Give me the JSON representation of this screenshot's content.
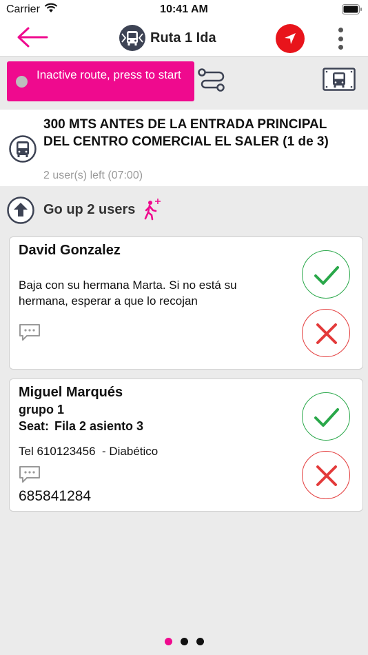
{
  "status_bar": {
    "carrier": "Carrier",
    "time": "10:41 AM"
  },
  "nav": {
    "title": "Ruta 1 Ida",
    "back_icon": "arrow-left-icon",
    "locate_icon": "navigation-arrow-icon",
    "more_icon": "vertical-dots-icon"
  },
  "route_control": {
    "start_label": "Inactive route, press to start",
    "accent_color": "#ef0a8e"
  },
  "stop": {
    "name": "300 MTS ANTES DE LA ENTRADA PRINCIPAL DEL CENTRO COMERCIAL EL SALER (1 de 3)",
    "users_left": "2 user(s) left (07:00)"
  },
  "go_up": {
    "label": "Go up 2 users"
  },
  "passengers": [
    {
      "name": "David Gonzalez",
      "note": "Baja con su hermana Marta. Si no está su hermana, esperar a que lo recojan"
    },
    {
      "name": "Miguel Marqués",
      "group": "grupo 1",
      "seat_label": "Seat:",
      "seat": "Fila 2 asiento 3",
      "tel": "Tel 610123456  - Diabético",
      "phone": "685841284"
    }
  ],
  "pagination": {
    "total": 3,
    "active": 1
  },
  "colors": {
    "accept": "#2aa84a",
    "reject": "#e33a3a",
    "locate": "#e8141b",
    "icon_dark": "#3d4354"
  }
}
